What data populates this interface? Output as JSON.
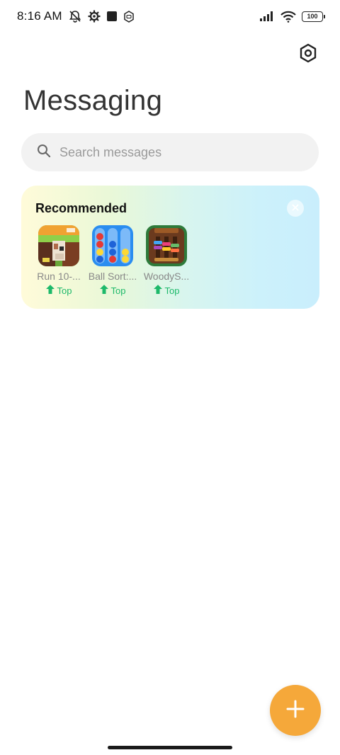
{
  "status_bar": {
    "time": "8:16 AM",
    "battery": "100",
    "icons": [
      "muted-bell-icon",
      "gear-icon",
      "square-icon",
      "shield-icon",
      "signal-icon",
      "wifi-icon",
      "battery-icon"
    ]
  },
  "header": {
    "title": "Messaging",
    "settings_icon": "settings-hexagon-icon"
  },
  "search": {
    "placeholder": "Search messages"
  },
  "recommended": {
    "title": "Recommended",
    "apps": [
      {
        "name": "Run 10-...",
        "badge": "Top"
      },
      {
        "name": "Ball Sort:...",
        "badge": "Top"
      },
      {
        "name": "WoodyS...",
        "badge": "Top"
      }
    ]
  },
  "colors": {
    "accent": "#f5a83a",
    "badge_green": "#1db96a",
    "search_bg": "#f2f2f2"
  }
}
